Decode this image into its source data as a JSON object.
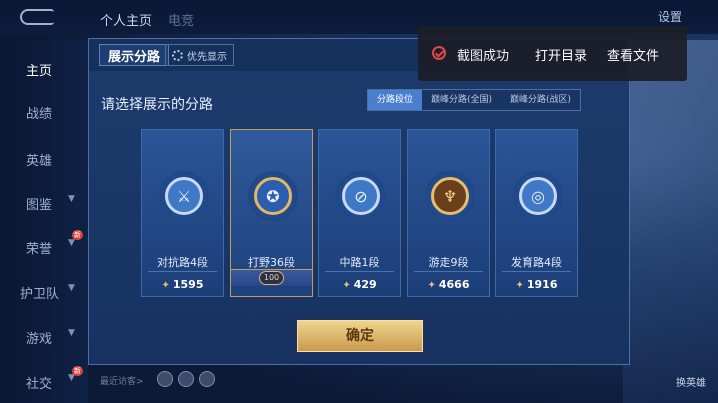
{
  "topbar": {
    "tabs": [
      "个人主页",
      "电竞"
    ],
    "settings": "设置"
  },
  "sidebar": {
    "items": [
      {
        "label": "主页",
        "active": true,
        "chevron": false,
        "badge": false
      },
      {
        "label": "战绩",
        "active": false,
        "chevron": false,
        "badge": false
      },
      {
        "label": "英雄",
        "active": false,
        "chevron": false,
        "badge": false
      },
      {
        "label": "图鉴",
        "active": false,
        "chevron": true,
        "badge": false
      },
      {
        "label": "荣誉",
        "active": false,
        "chevron": true,
        "badge": true
      },
      {
        "label": "护卫队",
        "active": false,
        "chevron": true,
        "badge": false
      },
      {
        "label": "游戏",
        "active": false,
        "chevron": true,
        "badge": false
      },
      {
        "label": "社交",
        "active": false,
        "chevron": true,
        "badge": true
      }
    ],
    "badge_text": "新"
  },
  "visitors": {
    "label": "最近访客>"
  },
  "right_side": {
    "label_bottom": "换英雄"
  },
  "panel": {
    "title": "展示分路",
    "priority_label": "优先显示",
    "prompt": "请选择展示的分路",
    "tabs": [
      {
        "label": "分路段位",
        "active": true
      },
      {
        "label": "巅峰分路(全国)",
        "active": false
      },
      {
        "label": "巅峰分路(战区)",
        "active": false
      }
    ],
    "cards": [
      {
        "name": "对抗路4段",
        "points": "1595",
        "icon": "crossed-swords-icon",
        "selected": false,
        "style": "silver"
      },
      {
        "name": "打野36段",
        "points": "",
        "stars": "100",
        "icon": "dragon-crest-icon",
        "selected": true,
        "style": "blue5"
      },
      {
        "name": "中路1段",
        "points": "429",
        "icon": "slash-shield-icon",
        "selected": false,
        "style": "silver"
      },
      {
        "name": "游走9段",
        "points": "4666",
        "icon": "wings-emblem-icon",
        "selected": false,
        "style": "gold"
      },
      {
        "name": "发育路4段",
        "points": "1916",
        "icon": "target-bow-icon",
        "selected": false,
        "style": "silver"
      }
    ],
    "confirm_label": "确定"
  },
  "toast": {
    "message": "截图成功",
    "open_dir": "打开目录",
    "view_file": "查看文件"
  },
  "colors": {
    "accent": "#4a7fd0",
    "gold": "#c79a58",
    "toast_icon": "#e0494a"
  }
}
